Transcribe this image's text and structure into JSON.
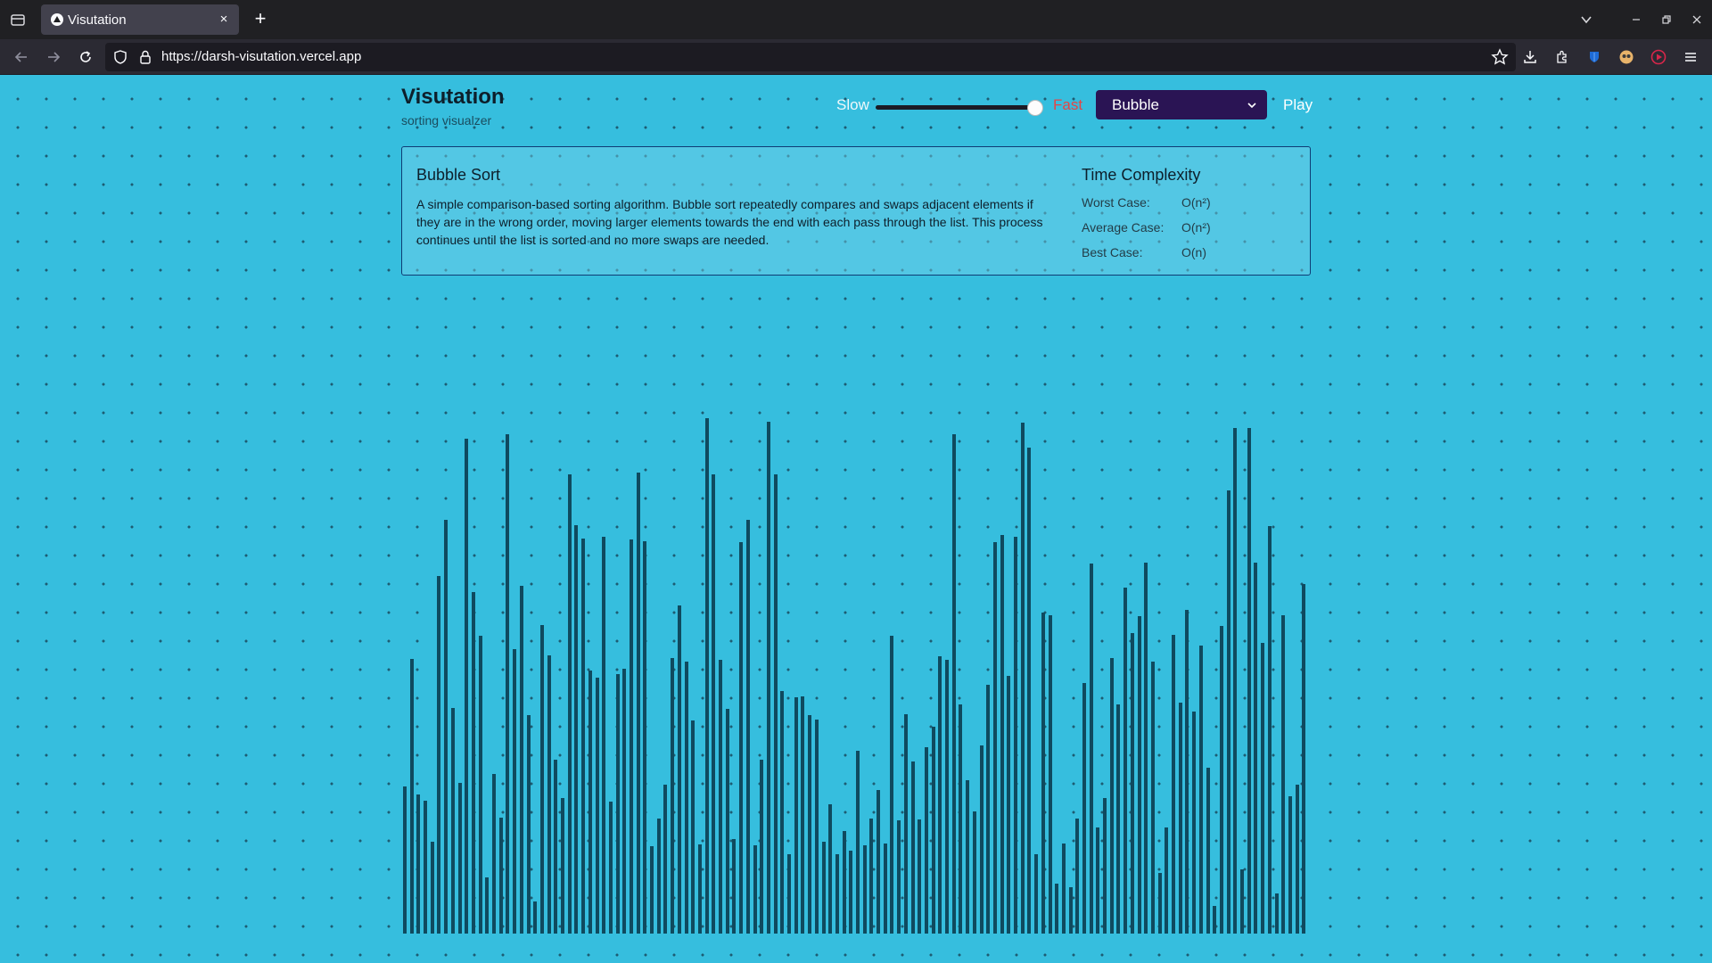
{
  "browser": {
    "tab_title": "Visutation",
    "tab_close": "×",
    "new_tab": "+",
    "url": "https://darsh-visutation.vercel.app"
  },
  "app": {
    "title": "Visutation",
    "subtitle": "sorting visualzer"
  },
  "controls": {
    "slow_label": "Slow",
    "fast_label": "Fast",
    "speed_level": 1.0,
    "algorithm_selected": "Bubble",
    "play_label": "Play"
  },
  "info": {
    "algorithm_name": "Bubble Sort",
    "description": "A simple comparison-based sorting algorithm. Bubble sort repeatedly compares and swaps adjacent elements if they are in the wrong order, moving larger elements towards the end with each pass through the list. This process continues until the list is sorted and no more swaps are needed.",
    "complexity_title": "Time Complexity",
    "worst_label": "Worst Case:",
    "worst_value": "O(n²)",
    "average_label": "Average Case:",
    "average_value": "O(n²)",
    "best_label": "Best Case:",
    "best_value": "O(n)"
  },
  "array": {
    "max_value": 580,
    "values": [
      166,
      310,
      157,
      150,
      104,
      403,
      466,
      254,
      170,
      558,
      385,
      336,
      63,
      180,
      131,
      563,
      321,
      392,
      246,
      36,
      348,
      314,
      196,
      153,
      518,
      460,
      445,
      297,
      288,
      447,
      149,
      293,
      299,
      444,
      520,
      442,
      99,
      130,
      168,
      311,
      370,
      307,
      240,
      101,
      581,
      518,
      309,
      253,
      107,
      441,
      466,
      100,
      196,
      577,
      518,
      273,
      89,
      266,
      267,
      246,
      241,
      104,
      146,
      89,
      116,
      93,
      206,
      100,
      130,
      162,
      102,
      336,
      128,
      247,
      194,
      129,
      210,
      233,
      313,
      309,
      563,
      258,
      173,
      138,
      212,
      280,
      441,
      449,
      290,
      447,
      576,
      548,
      89,
      362,
      359,
      56,
      102,
      52,
      130,
      282,
      417,
      120,
      153,
      311,
      258,
      390,
      339,
      358,
      418,
      307,
      68,
      120,
      337,
      260,
      365,
      250,
      325,
      187,
      31,
      347,
      500,
      570,
      72,
      570,
      418,
      328,
      459,
      45,
      359,
      155,
      168,
      394
    ]
  }
}
